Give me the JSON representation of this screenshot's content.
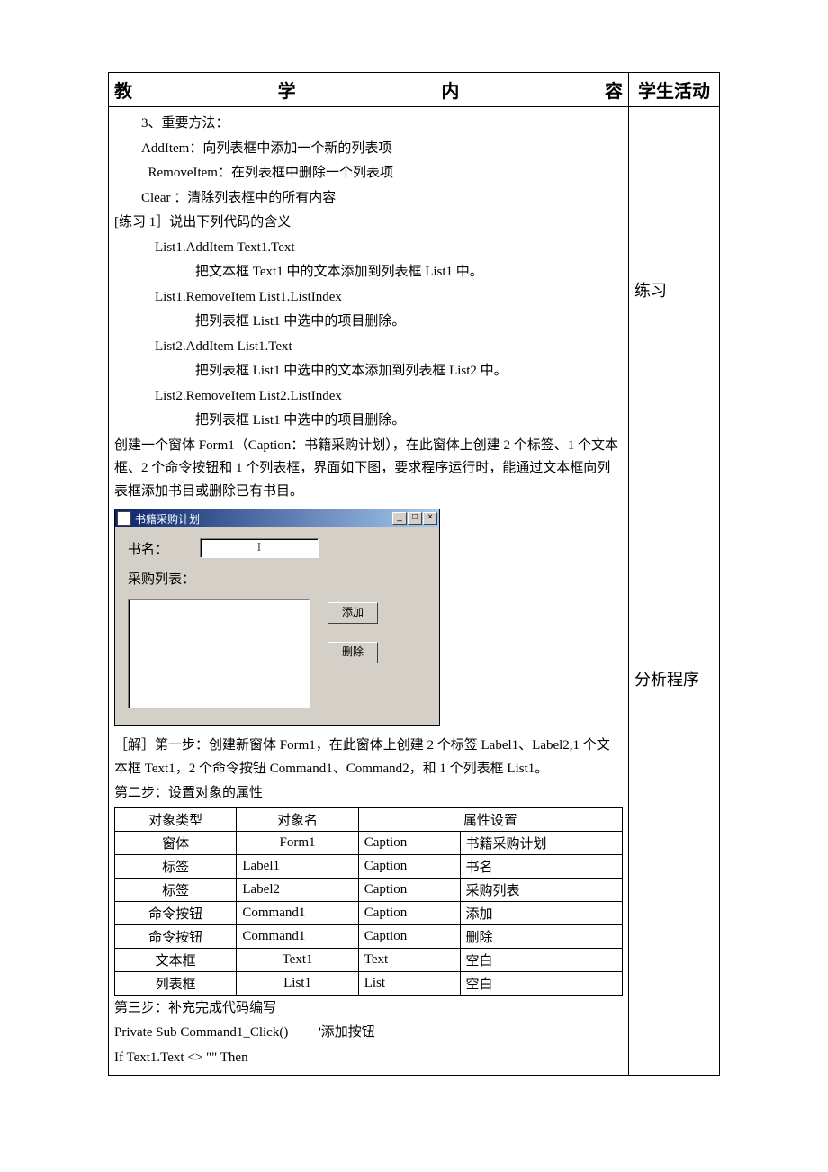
{
  "header": {
    "left": "教　　学　　内　　容",
    "right": "学生活动"
  },
  "sidebar": {
    "note1": "练习",
    "note2": "分析程序"
  },
  "content": {
    "p_methods_title": "3、重要方法：",
    "p_additem": "AddItem：向列表框中添加一个新的列表项",
    "p_removeitem": "RemoveItem：在列表框中删除一个列表项",
    "p_clear": "Clear ：清除列表框中的所有内容",
    "p_ex1_title": "[练习 1］说出下列代码的含义",
    "p_code1": "List1.AddItem Text1.Text",
    "p_desc1": "把文本框 Text1 中的文本添加到列表框 List1 中。",
    "p_code2": "List1.RemoveItem List1.ListIndex",
    "p_desc2": "把列表框 List1 中选中的项目删除。",
    "p_code3": "List2.AddItem List1.Text",
    "p_desc3": "把列表框 List1 中选中的文本添加到列表框 List2 中。",
    "p_code4": "List2.RemoveItem List2.ListIndex",
    "p_desc4": "把列表框 List1 中选中的项目删除。",
    "p_task": "创建一个窗体 Form1（Caption：书籍采购计划），在此窗体上创建 2 个标签、1 个文本框、2 个命令按钮和 1 个列表框，界面如下图，要求程序运行时，能通过文本框向列表框添加书目或删除已有书目。",
    "p_sol1": "［解］第一步：创建新窗体 Form1，在此窗体上创建 2 个标签 Label1、Label2,1 个文本框 Text1，2 个命令按钮 Command1、Command2，和 1 个列表框 List1。",
    "p_sol2": "第二步：设置对象的属性",
    "p_sol3": "第三步：补充完成代码编写",
    "p_code_a": "Private Sub Command1_Click()         '添加按钮",
    "p_code_b": "If Text1.Text <> \"\" Then"
  },
  "vbform": {
    "title": "书籍采购计划",
    "label_book": "书名：",
    "label_list": "采购列表：",
    "cursor": "I",
    "btn_add": "添加",
    "btn_del": "删除"
  },
  "props": {
    "h_type": "对象类型",
    "h_name": "对象名",
    "h_attr": "属性设置",
    "rows": [
      {
        "type": "窗体",
        "name": "Form1",
        "attr": "Caption",
        "val": "书籍采购计划"
      },
      {
        "type": "标签",
        "name": "Label1",
        "attr": "Caption",
        "val": "书名"
      },
      {
        "type": "标签",
        "name": "Label2",
        "attr": "Caption",
        "val": "采购列表"
      },
      {
        "type": "命令按钮",
        "name": "Command1",
        "attr": "Caption",
        "val": "添加"
      },
      {
        "type": "命令按钮",
        "name": "Command1",
        "attr": "Caption",
        "val": "删除"
      },
      {
        "type": "文本框",
        "name": "Text1",
        "attr": "Text",
        "val": "空白"
      },
      {
        "type": "列表框",
        "name": "List1",
        "attr": "List",
        "val": "空白"
      }
    ]
  }
}
